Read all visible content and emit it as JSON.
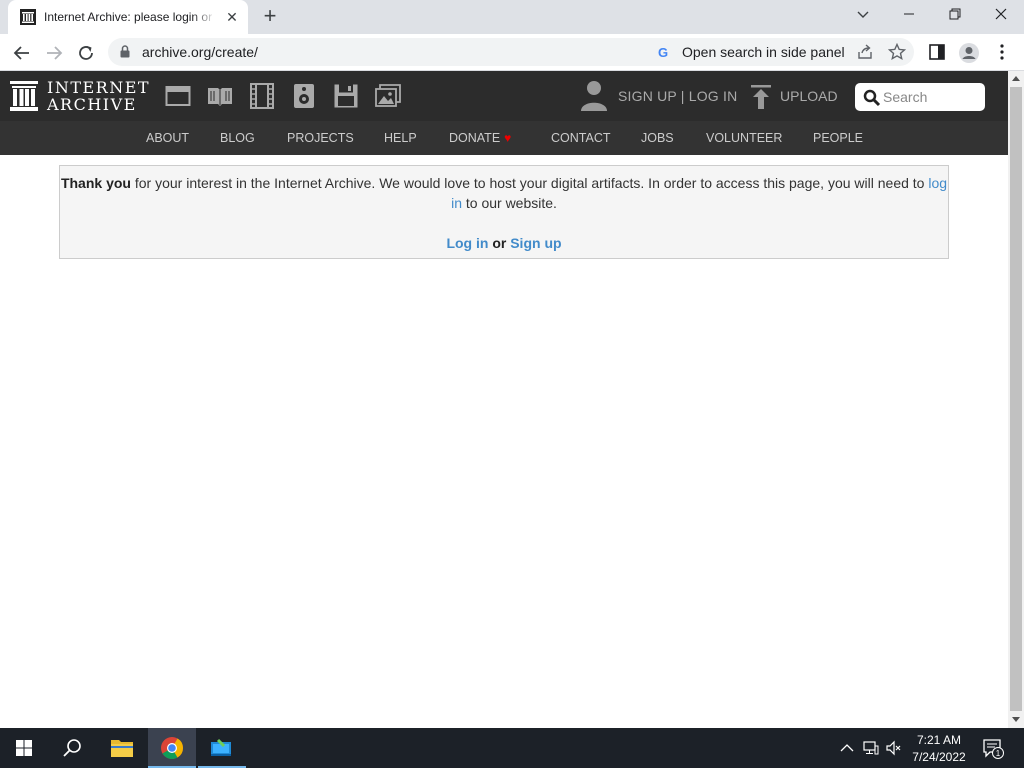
{
  "browser": {
    "tab_title": "Internet Archive: please login or sign up",
    "tab_close": "✕",
    "new_tab": "+",
    "url": "archive.org/create/",
    "side_panel_label": "Open search in side panel",
    "google_letter": "G"
  },
  "ia_header": {
    "logo_line1": "INTERNET",
    "logo_line2": "ARCHIVE",
    "media_icons": [
      "web-icon",
      "texts-icon",
      "video-icon",
      "audio-icon",
      "software-icon",
      "images-icon"
    ],
    "signup_login": "SIGN UP | LOG IN",
    "upload": "UPLOAD",
    "search_placeholder": "Search"
  },
  "ia_nav": {
    "items": [
      "ABOUT",
      "BLOG",
      "PROJECTS",
      "HELP",
      "DONATE",
      "CONTACT",
      "JOBS",
      "VOLUNTEER",
      "PEOPLE"
    ],
    "donate_heart": "♥"
  },
  "notice": {
    "thank_you": "Thank you",
    "message_part1": " for your interest in the Internet Archive. We would love to host your digital artifacts. In order to access this page, you will need to ",
    "login_link": "log in",
    "message_part2": " to our website.",
    "login_button": "Log in",
    "or": " or ",
    "signup_button": "Sign up"
  },
  "taskbar": {
    "time": "7:21 AM",
    "date": "7/24/2022",
    "notification_count": "1"
  },
  "colors": {
    "ia_header_bg": "#2c2c2c",
    "ia_nav_bg": "#333333",
    "link": "#428bca",
    "donate_heart": "#e00000"
  }
}
